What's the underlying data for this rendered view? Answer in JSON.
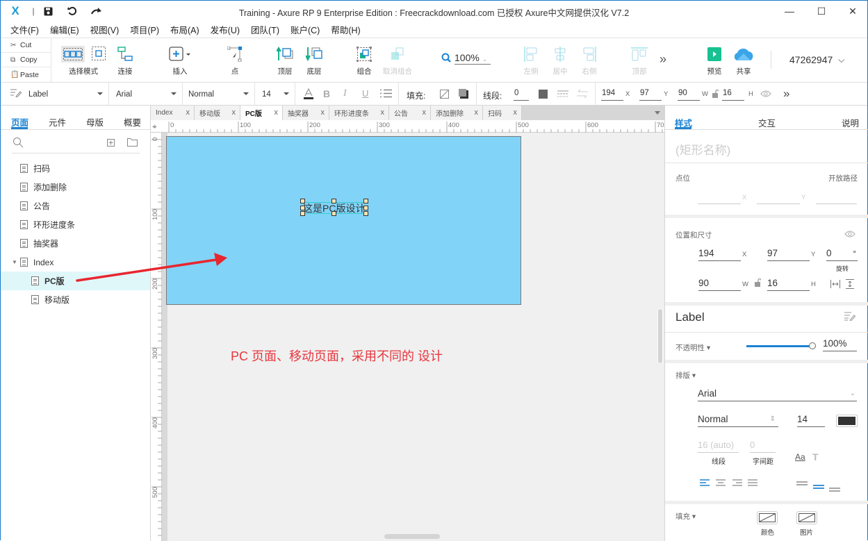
{
  "window": {
    "title": "Training - Axure RP 9 Enterprise Edition : Freecrackdownload.com 已授权    Axure中文网提供汉化 V7.2",
    "minimize": "—",
    "maximize": "☐",
    "close": "✕"
  },
  "quick_access": {
    "logo": "X",
    "divider": "|",
    "save": "💾",
    "undo": "↺",
    "redo": "↷"
  },
  "menu": [
    "文件(F)",
    "编辑(E)",
    "视图(V)",
    "项目(P)",
    "布局(A)",
    "发布(U)",
    "团队(T)",
    "账户(C)",
    "帮助(H)"
  ],
  "clipboard": [
    {
      "icon": "✂",
      "label": "Cut"
    },
    {
      "icon": "⧉",
      "label": "Copy"
    },
    {
      "icon": "📋",
      "label": "Paste"
    }
  ],
  "toolbar": {
    "select_mode": "选择模式",
    "connect": "连接",
    "insert": "插入",
    "point": "点",
    "top_layer": "顶层",
    "bottom_layer": "底层",
    "group": "组合",
    "ungroup": "取消组合",
    "zoom": "100%",
    "align_left": "左侧",
    "align_center": "居中",
    "align_right": "右侧",
    "align_top": "顶部",
    "more": "»",
    "preview": "预览",
    "share": "共享",
    "account": "47262947"
  },
  "format_bar": {
    "widget_style": "Label",
    "font_family": "Arial",
    "font_weight": "Normal",
    "font_size": "14",
    "fill_label": "填充:",
    "stroke_label": "线段:",
    "stroke_width": "0",
    "x": "194",
    "x_suffix": "X",
    "y": "97",
    "y_suffix": "Y",
    "w": "90",
    "w_suffix": "W",
    "h": "16",
    "h_suffix": "H",
    "more": "»"
  },
  "left_panel": {
    "tabs": [
      "页面",
      "元件",
      "母版",
      "概要"
    ],
    "active_tab": 0,
    "pages": [
      {
        "label": "扫码",
        "level": 0
      },
      {
        "label": "添加删除",
        "level": 0
      },
      {
        "label": "公告",
        "level": 0
      },
      {
        "label": "环形进度条",
        "level": 0
      },
      {
        "label": "抽奖器",
        "level": 0
      },
      {
        "label": "Index",
        "level": 0,
        "expanded": true
      },
      {
        "label": "PC版",
        "level": 1,
        "selected": true
      },
      {
        "label": "移动版",
        "level": 1
      }
    ]
  },
  "doc_tabs": [
    {
      "label": "Index"
    },
    {
      "label": "移动版"
    },
    {
      "label": "PC版",
      "active": true
    },
    {
      "label": "抽奖器"
    },
    {
      "label": "环形进度条"
    },
    {
      "label": "公告"
    },
    {
      "label": "添加删除"
    },
    {
      "label": "扫码"
    }
  ],
  "ruler": {
    "horizontal": [
      "0",
      "100",
      "200",
      "300",
      "400",
      "500",
      "600",
      "70"
    ],
    "vertical": [
      "0",
      "100",
      "200",
      "300",
      "400",
      "500"
    ]
  },
  "canvas": {
    "rect_fill": "#81d3f8",
    "label_text": "这是PC版设计",
    "annotation": "PC 页面、移动页面，采用不同的 设计",
    "annotation_color": "#e8363e",
    "arrow_color": "#e8262e"
  },
  "right_panel": {
    "tabs": [
      "样式",
      "交互",
      "说明"
    ],
    "active_tab": 0,
    "shape_name_placeholder": "(矩形名称)",
    "points_label": "点位",
    "open_path": "开放路径",
    "point_x_suffix": "X",
    "point_y_suffix": "Y",
    "position_size_label": "位置和尺寸",
    "x": "194",
    "x_suffix": "X",
    "y": "97",
    "y_suffix": "Y",
    "rotation": "0",
    "rotation_suffix": "°",
    "rotation_label": "旋转",
    "w": "90",
    "w_suffix": "W",
    "h": "16",
    "h_suffix": "H",
    "style_name": "Label",
    "opacity_label": "不透明性 ▾",
    "opacity_value": "100%",
    "opacity_fraction": 1.0,
    "typography_label": "排版 ▾",
    "font_family": "Arial",
    "font_weight": "Normal",
    "font_size": "14",
    "font_color": "#333333",
    "line_height": "16 (auto)",
    "line_height_label": "线段",
    "letter_spacing": "0",
    "letter_spacing_label": "字间距",
    "fill_label": "填充 ▾",
    "fill_color_label": "颜色",
    "fill_image_label": "图片"
  }
}
